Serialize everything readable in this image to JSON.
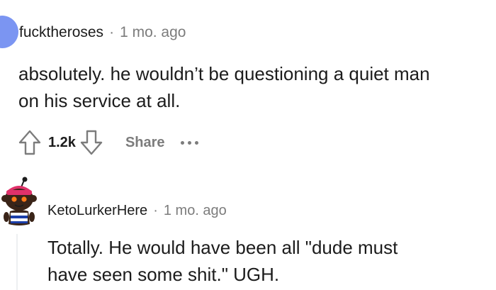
{
  "comments": [
    {
      "author": "fucktheroses",
      "separator": "·",
      "time": "1 mo. ago",
      "body_line1": "absolutely. he wouldn’t be questioning a quiet man",
      "body_line2": "on his service at all.",
      "score": "1.2k",
      "share_label": "Share"
    },
    {
      "author": "KetoLurkerHere",
      "separator": "·",
      "time": "1 mo. ago",
      "body_line1": "Totally. He would have been all \"dude must",
      "body_line2": "have seen some shit.\" UGH."
    }
  ],
  "colors": {
    "avatar1": "#7b95f2",
    "meta_gray": "#7c7c7c",
    "text": "#1c1c1c",
    "thread_line": "#edeff1"
  },
  "icons": [
    "upvote-icon",
    "downvote-icon",
    "more-options-icon"
  ]
}
